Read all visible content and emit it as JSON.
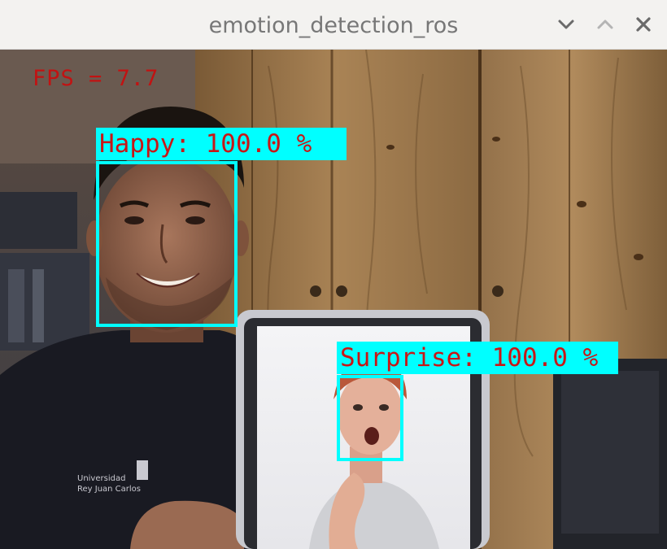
{
  "window": {
    "title": "emotion_detection_ros",
    "controls": [
      "minimize",
      "maximize",
      "close"
    ]
  },
  "video": {
    "fps_text": "FPS = 7.7",
    "detections": [
      {
        "label": "Happy: 100.0 %"
      },
      {
        "label": "Surprise: 100.0 %"
      }
    ]
  },
  "colors": {
    "box": "#00ffff",
    "label_text": "#c81616",
    "fps_text": "#c21212"
  }
}
